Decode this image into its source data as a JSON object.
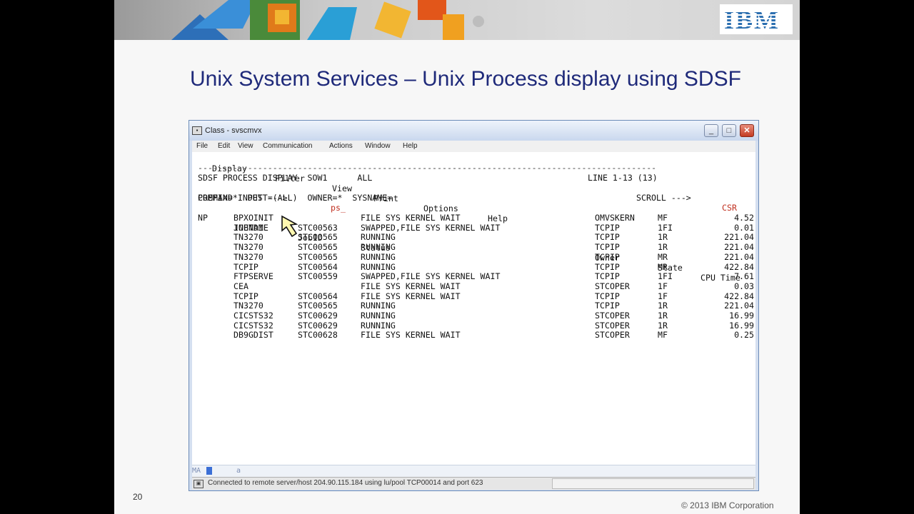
{
  "slide": {
    "title": "Unix System Services – Unix Process display using SDSF",
    "page_number": "20",
    "copyright": "© 2013 IBM Corporation",
    "logo_text": "IBM"
  },
  "window": {
    "title": "Class - svscmvx",
    "buttons": {
      "minimize": "_",
      "maximize": "□",
      "close": "✕"
    },
    "menu": [
      "File",
      "Edit",
      "View",
      "Communication",
      "Actions",
      "Window",
      "Help"
    ]
  },
  "terminal": {
    "menu": [
      "Display",
      "Filter",
      "View",
      "Print",
      "Options",
      "Help"
    ],
    "separator": "--------------------------------------------------------------------------------------------",
    "header_left": "SDSF PROCESS DISPLAY  SOW1      ALL",
    "header_right": "LINE 1-13 (13)",
    "command_label": "COMMAND INPUT ---> ",
    "command_value": "ps_",
    "scroll_label": "SCROLL ---> ",
    "scroll_value": "CSR",
    "prefix_line": "PREFIX=*  DEST=(ALL)  OWNER=*  SYSNAME=",
    "columns": [
      "NP",
      "JOBNAME",
      "JobID",
      "Status",
      "Owner",
      "State",
      "CPU Time"
    ],
    "rows": [
      {
        "job": "BPXOINIT",
        "jobid": "",
        "status": "FILE SYS KERNEL WAIT",
        "owner": "OMVSKERN",
        "state": "MF",
        "cpu": "4.52"
      },
      {
        "job": "INETD1",
        "jobid": "STC00563",
        "status": "SWAPPED,FILE SYS KERNEL WAIT",
        "owner": "TCPIP",
        "state": "1FI",
        "cpu": "0.01"
      },
      {
        "job": "TN3270",
        "jobid": "STC00565",
        "status": "RUNNING",
        "owner": "TCPIP",
        "state": "1R",
        "cpu": "221.04"
      },
      {
        "job": "TN3270",
        "jobid": "STC00565",
        "status": "RUNNING",
        "owner": "TCPIP",
        "state": "1R",
        "cpu": "221.04"
      },
      {
        "job": "TN3270",
        "jobid": "STC00565",
        "status": "RUNNING",
        "owner": "TCPIP",
        "state": "MR",
        "cpu": "221.04"
      },
      {
        "job": "TCPIP",
        "jobid": "STC00564",
        "status": "RUNNING",
        "owner": "TCPIP",
        "state": "MR",
        "cpu": "422.84"
      },
      {
        "job": "FTPSERVE",
        "jobid": "STC00559",
        "status": "SWAPPED,FILE SYS KERNEL WAIT",
        "owner": "TCPIP",
        "state": "1FI",
        "cpu": "7.61"
      },
      {
        "job": "CEA",
        "jobid": "",
        "status": "FILE SYS KERNEL WAIT",
        "owner": "STCOPER",
        "state": "1F",
        "cpu": "0.03"
      },
      {
        "job": "TCPIP",
        "jobid": "STC00564",
        "status": "FILE SYS KERNEL WAIT",
        "owner": "TCPIP",
        "state": "1F",
        "cpu": "422.84"
      },
      {
        "job": "TN3270",
        "jobid": "STC00565",
        "status": "RUNNING",
        "owner": "TCPIP",
        "state": "1R",
        "cpu": "221.04"
      },
      {
        "job": "CICSTS32",
        "jobid": "STC00629",
        "status": "RUNNING",
        "owner": "STCOPER",
        "state": "1R",
        "cpu": "16.99"
      },
      {
        "job": "CICSTS32",
        "jobid": "STC00629",
        "status": "RUNNING",
        "owner": "STCOPER",
        "state": "1R",
        "cpu": "16.99"
      },
      {
        "job": "DB9GDIST",
        "jobid": "STC00628",
        "status": "FILE SYS KERNEL WAIT",
        "owner": "STCOPER",
        "state": "MF",
        "cpu": "0.25"
      }
    ]
  },
  "oia": {
    "ma": "MA",
    "position": "a"
  },
  "status_bar": {
    "text": "Connected to remote server/host 204.90.115.184 using lu/pool TCP00014 and port 623"
  },
  "colors": {
    "title": "#1f2a7a",
    "accent_red": "#c03020",
    "cursor_blue": "#3b6fd6"
  }
}
